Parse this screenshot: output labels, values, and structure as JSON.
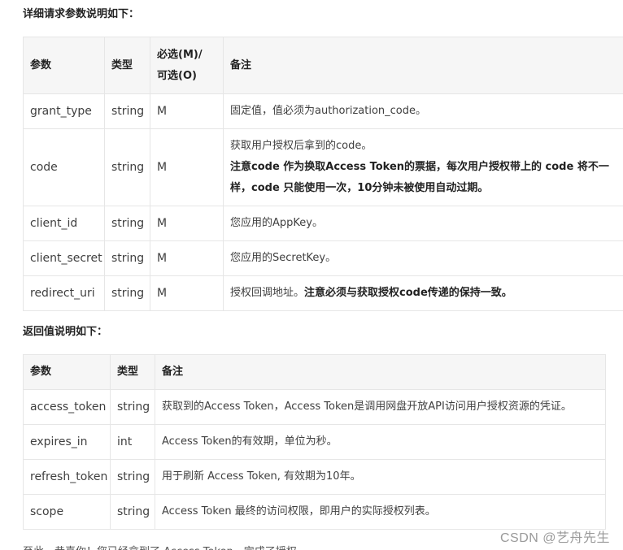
{
  "request": {
    "title": "详细请求参数说明如下：",
    "headers": {
      "param": "参数",
      "type": "类型",
      "required_1": "必选(M)/",
      "required_2": "可选(O)",
      "note": "备注"
    },
    "rows": [
      {
        "param": "grant_type",
        "type": "string",
        "req": "M",
        "note": "固定值，值必须为authorization_code。"
      },
      {
        "param": "code",
        "type": "string",
        "req": "M",
        "note_line1": "获取用户授权后拿到的code。",
        "note_bold": "注意code 作为换取Access Token的票据，每次用户授权带上的 code 将不一样，code 只能使用一次，10分钟未被使用自动过期。"
      },
      {
        "param": "client_id",
        "type": "string",
        "req": "M",
        "note": "您应用的AppKey。"
      },
      {
        "param": "client_secret",
        "type": "string",
        "req": "M",
        "note": "您应用的SecretKey。"
      },
      {
        "param": "redirect_uri",
        "type": "string",
        "req": "M",
        "note_plain": "授权回调地址。",
        "note_bold": "注意必须与获取授权code传递的保持一致。"
      }
    ]
  },
  "response": {
    "title": "返回值说明如下：",
    "headers": {
      "param": "参数",
      "type": "类型",
      "note": "备注"
    },
    "rows": [
      {
        "param": "access_token",
        "type": "string",
        "note": "获取到的Access Token，Access Token是调用网盘开放API访问用户授权资源的凭证。"
      },
      {
        "param": "expires_in",
        "type": "int",
        "note": "Access Token的有效期，单位为秒。"
      },
      {
        "param": "refresh_token",
        "type": "string",
        "note": "用于刷新 Access Token, 有效期为10年。"
      },
      {
        "param": "scope",
        "type": "string",
        "note": "Access Token 最终的访问权限，即用户的实际授权列表。"
      }
    ]
  },
  "footer_text": "至此，恭喜你！您已经拿到了 Access Token，完成了授权。",
  "watermark": "CSDN @艺舟先生"
}
